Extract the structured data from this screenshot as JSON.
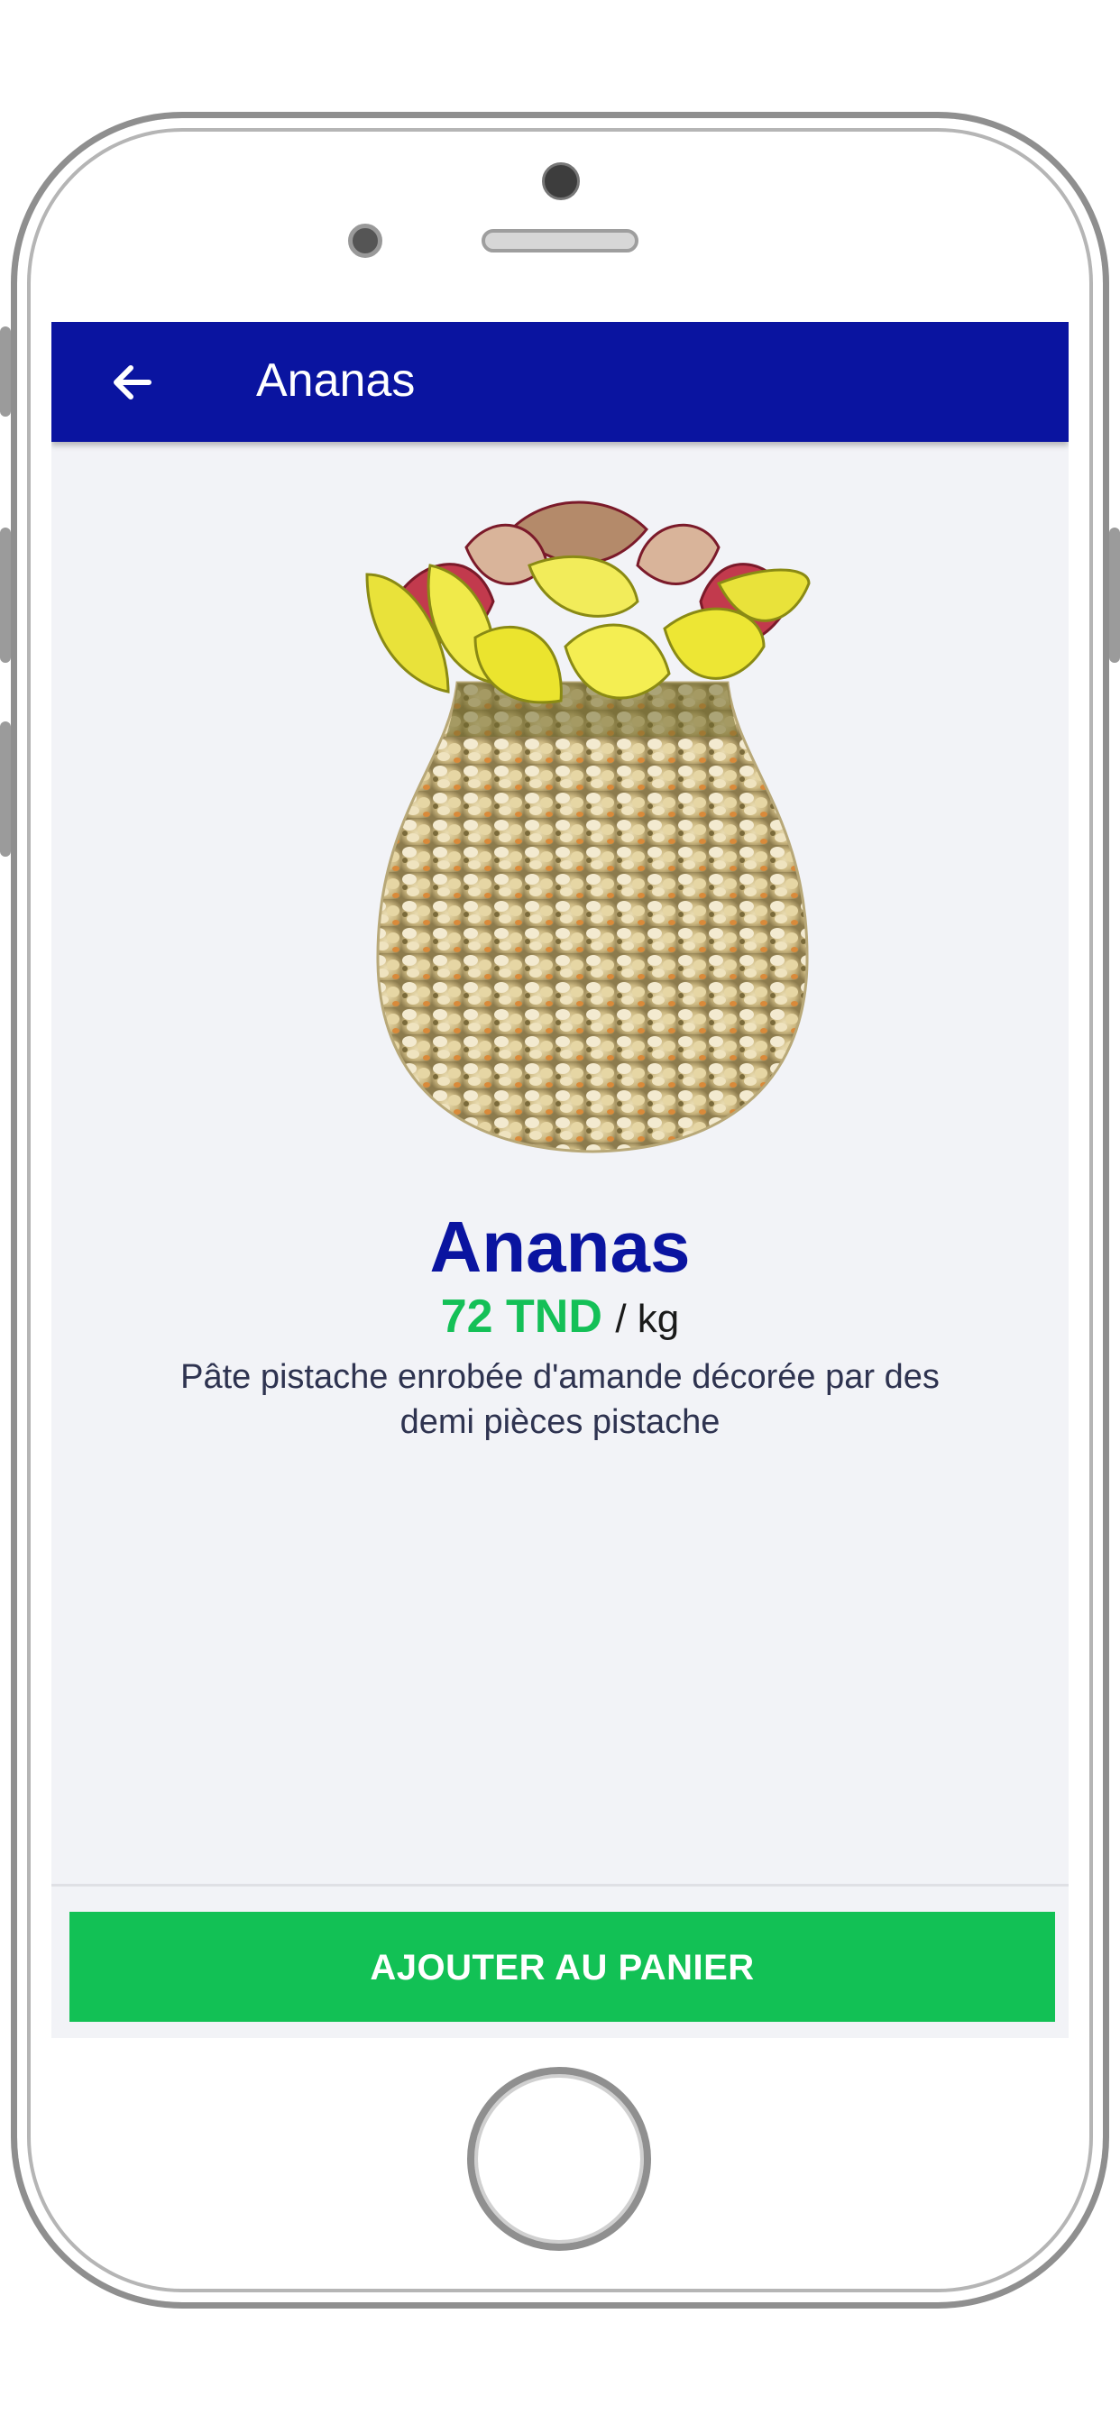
{
  "appbar": {
    "title": "Ananas",
    "back_icon": "arrow-left-icon",
    "background": "#0a14a0"
  },
  "product": {
    "name": "Ananas",
    "price": "72 TND",
    "unit": "/ kg",
    "description": "Pâte pistache enrobée d'amande décorée par des demi pièces pistache",
    "image": "pineapple-shaped-pistachio-pastry"
  },
  "actions": {
    "add_to_cart_label": "AJOUTER AU PANIER",
    "add_to_cart_color": "#12c155"
  },
  "colors": {
    "accent": "#0a14a0",
    "price": "#14c057",
    "screen_background": "#f2f3f7"
  }
}
